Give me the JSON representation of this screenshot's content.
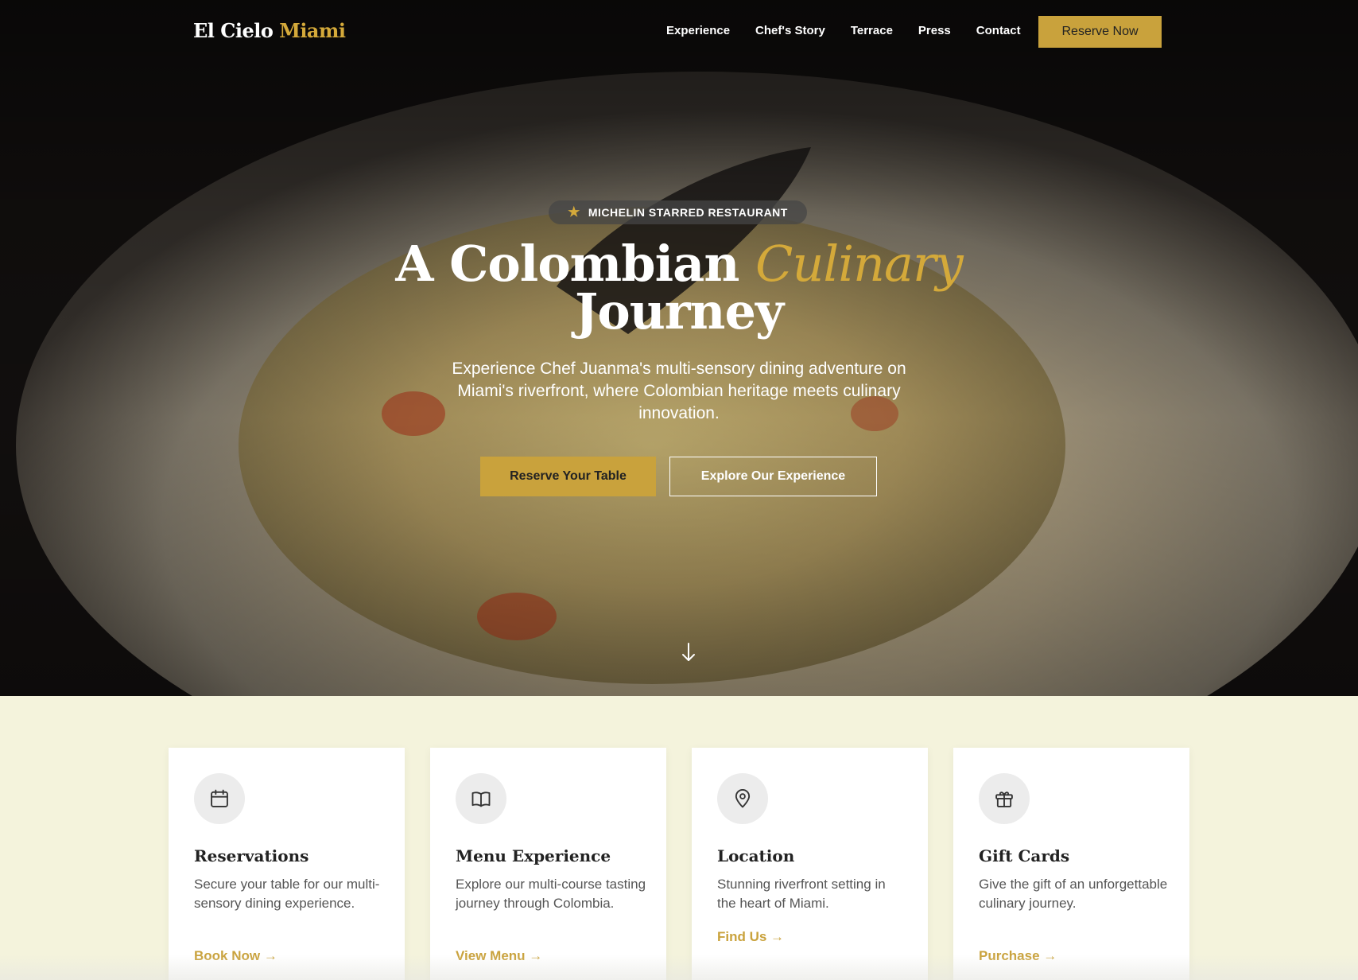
{
  "brand": {
    "name": "El Cielo",
    "accent": "Miami"
  },
  "nav": {
    "links": [
      "Experience",
      "Chef's Story",
      "Terrace",
      "Press",
      "Contact"
    ],
    "cta": "Reserve Now"
  },
  "hero": {
    "badge": "MICHELIN STARRED RESTAURANT",
    "badge_icon": "star-icon",
    "headline_part1": "A Colombian ",
    "headline_accent": "Culinary",
    "headline_part2": "Journey",
    "subtitle": "Experience Chef Juanma's multi-sensory dining adventure on Miami's riverfront, where Colombian heritage meets culinary innovation.",
    "primary_button": "Reserve Your Table",
    "secondary_button": "Explore Our Experience",
    "scroll_icon": "arrow-down-icon"
  },
  "cards": [
    {
      "icon": "calendar-icon",
      "title": "Reservations",
      "text": "Secure your table for our multi-sensory dining experience.",
      "link": "Book Now →"
    },
    {
      "icon": "book-icon",
      "title": "Menu Experience",
      "text": "Explore our multi-course tasting journey through Colombia.",
      "link": "View Menu →"
    },
    {
      "icon": "map-pin-icon",
      "title": "Location",
      "text": "Stunning riverfront setting in the heart of Miami.",
      "link": "Find Us →"
    },
    {
      "icon": "gift-icon",
      "title": "Gift Cards",
      "text": "Give the gift of an unforgettable culinary journey.",
      "link": "Purchase →"
    }
  ],
  "colors": {
    "accent": "#c9a23c",
    "section_bg": "#f4f3dc",
    "hero_dark": "#0c0a09"
  }
}
